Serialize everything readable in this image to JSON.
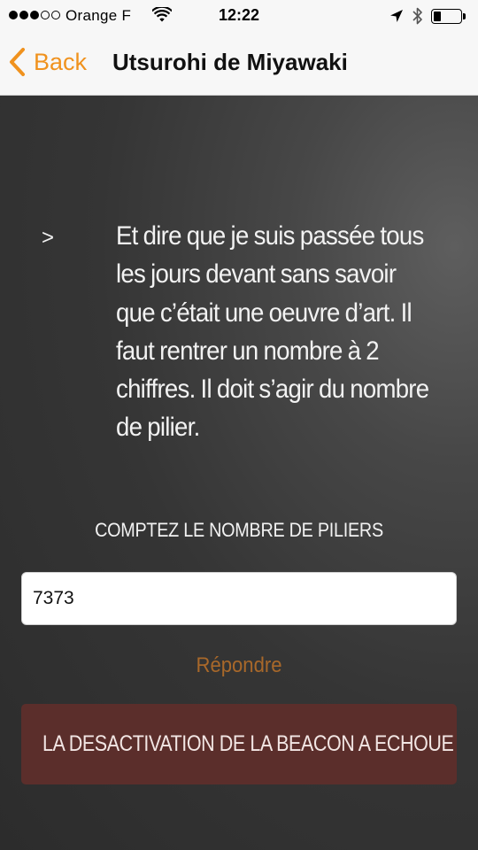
{
  "status_bar": {
    "signal_bars_filled": 3,
    "signal_bars_total": 5,
    "carrier": "Orange F",
    "time": "12:22",
    "icons": [
      "wifi-icon",
      "location-arrow-icon",
      "bluetooth-icon",
      "battery-icon"
    ],
    "battery_level": 0.2
  },
  "nav": {
    "back_label": "Back",
    "title": "Utsurohi de Miyawaki",
    "accent_color": "#f0921e"
  },
  "clue": {
    "bullet": ">",
    "text": "Et dire que je suis passée tous les jours devant sans savoir que c’était une oeuvre d’art. Il faut rentrer un nombre à 2 chiffres. Il doit s’agir du nombre de pilier."
  },
  "question": {
    "label": "COMPTEZ LE NOMBRE DE PILIERS"
  },
  "answer_input": {
    "value": "7373"
  },
  "submit": {
    "label": "Répondre",
    "color": "#a8682a"
  },
  "error": {
    "message": "LA DESACTIVATION DE LA BEACON A ECHOUE",
    "background": "#5b2e2b"
  }
}
